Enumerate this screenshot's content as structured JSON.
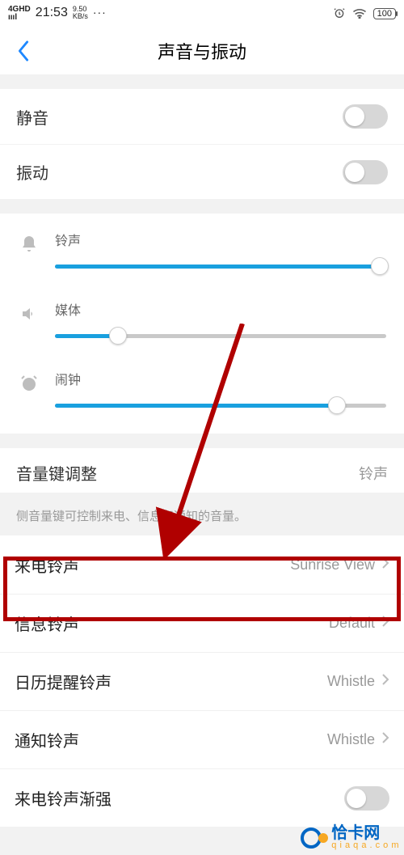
{
  "status": {
    "network": "4GHD",
    "time": "21:53",
    "speed_top": "9.50",
    "speed_bot": "KB/s",
    "dots": "···",
    "battery": "100"
  },
  "header": {
    "title": "声音与振动"
  },
  "toggles": {
    "mute": {
      "label": "静音",
      "on": false
    },
    "vibrate": {
      "label": "振动",
      "on": false
    }
  },
  "sliders": {
    "ringtone": {
      "label": "铃声",
      "percent": 98
    },
    "media": {
      "label": "媒体",
      "percent": 19
    },
    "alarm": {
      "label": "闹钟",
      "percent": 85
    }
  },
  "volume_key": {
    "title": "音量键调整",
    "value": "铃声",
    "desc": "侧音量键可控制来电、信息和通知的音量。"
  },
  "ringtones": {
    "incoming": {
      "label": "来电铃声",
      "value": "Sunrise View"
    },
    "message": {
      "label": "信息铃声",
      "value": "Default"
    },
    "calendar": {
      "label": "日历提醒铃声",
      "value": "Whistle"
    },
    "notify": {
      "label": "通知铃声",
      "value": "Whistle"
    },
    "crescendo": {
      "label": "来电铃声渐强",
      "on": false
    }
  },
  "watermark": {
    "name": "恰卡网",
    "url": "q i a q a . c o m"
  }
}
